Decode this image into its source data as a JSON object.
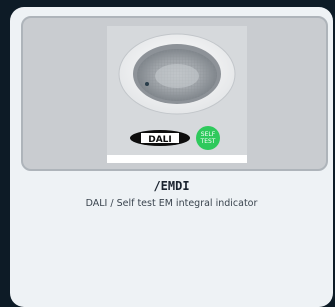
{
  "product": {
    "title": "/EMDI",
    "description": "DALI / Self test EM integral indicator"
  },
  "badges": {
    "dali_label": "DALI",
    "selftest_line1": "SELF",
    "selftest_line2": "TEST"
  },
  "colors": {
    "page_background": "#0d1b26",
    "card_background": "#eef2f5",
    "selftest_badge": "#2ec95c"
  },
  "icons": {
    "dali": "dali-logo-icon",
    "selftest": "self-test-badge-icon"
  }
}
